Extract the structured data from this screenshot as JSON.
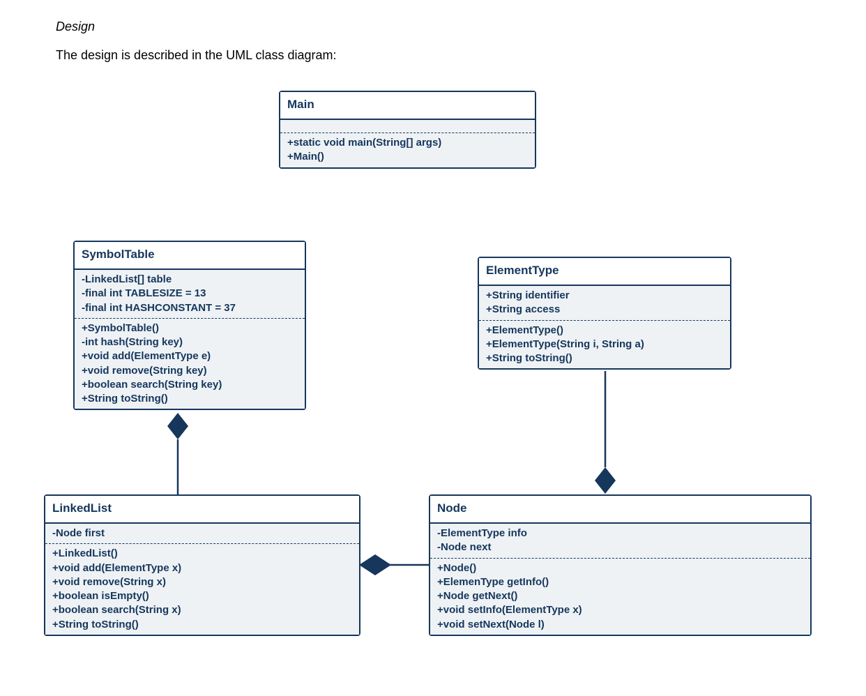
{
  "header": {
    "title": "Design",
    "description": "The design is described in the UML class diagram:"
  },
  "classes": {
    "main": {
      "name": "Main",
      "methods": [
        "+static void main(String[] args)",
        "+Main()"
      ]
    },
    "symbolTable": {
      "name": "SymbolTable",
      "attributes": [
        "-LinkedList[] table",
        "-final int TABLESIZE = 13",
        "-final int HASHCONSTANT = 37"
      ],
      "methods": [
        "+SymbolTable()",
        "-int hash(String key)",
        "+void add(ElementType e)",
        "+void remove(String key)",
        "+boolean search(String key)",
        "+String toString()"
      ]
    },
    "elementType": {
      "name": "ElementType",
      "attributes": [
        "+String identifier",
        "+String access"
      ],
      "methods": [
        "+ElementType()",
        "+ElementType(String i, String a)",
        "+String toString()"
      ]
    },
    "linkedList": {
      "name": "LinkedList",
      "attributes": [
        "-Node first"
      ],
      "methods": [
        "+LinkedList()",
        "+void add(ElementType x)",
        "+void remove(String x)",
        "+boolean isEmpty()",
        "+boolean search(String x)",
        "+String toString()"
      ]
    },
    "node": {
      "name": "Node",
      "attributes": [
        "-ElementType info",
        "-Node next"
      ],
      "methods": [
        "+Node()",
        "+ElemenType getInfo()",
        "+Node getNext()",
        "+void setInfo(ElementType x)",
        "+void setNext(Node l)"
      ]
    }
  }
}
